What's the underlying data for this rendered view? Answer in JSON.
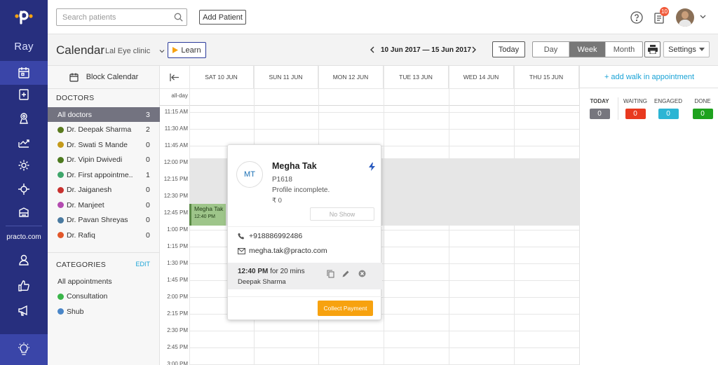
{
  "brand": {
    "ray_label": "Ray",
    "practo_label": "practo.com"
  },
  "topbar": {
    "search_placeholder": "Search patients",
    "add_patient": "Add Patient",
    "notification_count": "10"
  },
  "subbar": {
    "title": "Calendar",
    "clinic": "Lal Eye clinic",
    "learn": "Learn",
    "date_range": "10 Jun 2017 — 15 Jun 2017",
    "today": "Today",
    "views": [
      "Day",
      "Week",
      "Month"
    ],
    "active_view": "Week",
    "settings": "Settings"
  },
  "left": {
    "block_calendar": "Block Calendar",
    "doctors_heading": "DOCTORS",
    "doctors": [
      {
        "name": "All doctors",
        "count": "3",
        "color": ""
      },
      {
        "name": "Dr. Deepak Sharma",
        "count": "2",
        "color": "#5a7a1e"
      },
      {
        "name": "Dr. Swati S Mande",
        "count": "0",
        "color": "#c49a1a"
      },
      {
        "name": "Dr. Vipin Dwivedi",
        "count": "0",
        "color": "#4d7a1f"
      },
      {
        "name": "Dr. First appointme..",
        "count": "1",
        "color": "#3fa66b"
      },
      {
        "name": "Dr. Jaiganesh",
        "count": "0",
        "color": "#c8312f"
      },
      {
        "name": "Dr. Manjeet",
        "count": "0",
        "color": "#b34bb0"
      },
      {
        "name": "Dr. Pavan Shreyas",
        "count": "0",
        "color": "#4a7aa0"
      },
      {
        "name": "Dr. Rafiq",
        "count": "0",
        "color": "#e2572a"
      }
    ],
    "categories_heading": "CATEGORIES",
    "edit": "EDIT",
    "categories": [
      {
        "name": "All appointments",
        "color": ""
      },
      {
        "name": "Consultation",
        "color": "#3ab54a"
      },
      {
        "name": "Shub",
        "color": "#4a86c8"
      }
    ]
  },
  "grid": {
    "days": [
      "SAT 10 JUN",
      "SUN 11 JUN",
      "MON 12 JUN",
      "TUE 13 JUN",
      "WED 14 JUN",
      "THU 15 JUN"
    ],
    "allday": "all-day",
    "times": [
      "11:15 AM",
      "11:30 AM",
      "11:45 AM",
      "12:00 PM",
      "12:15 PM",
      "12:30 PM",
      "12:45 PM",
      "1:00 PM",
      "1:15 PM",
      "1:30 PM",
      "1:45 PM",
      "2:00 PM",
      "2:15 PM",
      "2:30 PM",
      "2:45 PM",
      "3:00 PM"
    ],
    "event": {
      "name": "Megha Tak",
      "time": "12:40 PM"
    }
  },
  "right": {
    "walkin": "+ add walk in appointment",
    "stats": [
      {
        "label": "TODAY",
        "value": "0",
        "color": "#76767e"
      },
      {
        "label": "WAITING",
        "value": "0",
        "color": "#e8391f"
      },
      {
        "label": "ENGAGED",
        "value": "0",
        "color": "#2bb5d4"
      },
      {
        "label": "DONE",
        "value": "0",
        "color": "#1ea21e"
      }
    ]
  },
  "popup": {
    "initials": "MT",
    "name": "Megha Tak",
    "pid": "P1618",
    "incomplete": "Profile incomplete.",
    "balance": "₹ 0",
    "no_show": "No Show",
    "phone": "+918886992486",
    "email": "megha.tak@practo.com",
    "appt_time": "12:40 PM",
    "appt_duration": " for 20 mins",
    "appt_doctor": "Deepak Sharma",
    "collect": "Collect Payment"
  }
}
